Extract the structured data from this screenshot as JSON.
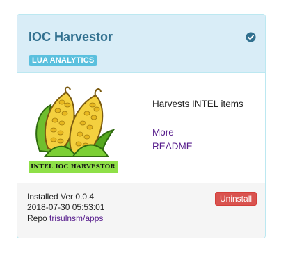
{
  "app": {
    "title": "IOC Harvestor",
    "badge": "LUA ANALYTICS",
    "installed_icon": "check-circle-icon",
    "logo_caption": "INTEL IOC HARVESTOR",
    "description": "Harvests INTEL items",
    "links": {
      "more": "More",
      "readme": "README"
    }
  },
  "footer": {
    "installed_version": "Installed Ver 0.0.4",
    "installed_date": "2018-07-30 05:53:01",
    "repo_label": "Repo",
    "repo_link": "trisulnsm/apps",
    "uninstall_label": "Uninstall"
  },
  "colors": {
    "header_bg": "#d9edf7",
    "title": "#31708f",
    "badge_bg": "#5bc0de",
    "link": "#551a8b",
    "danger": "#d9534f"
  }
}
